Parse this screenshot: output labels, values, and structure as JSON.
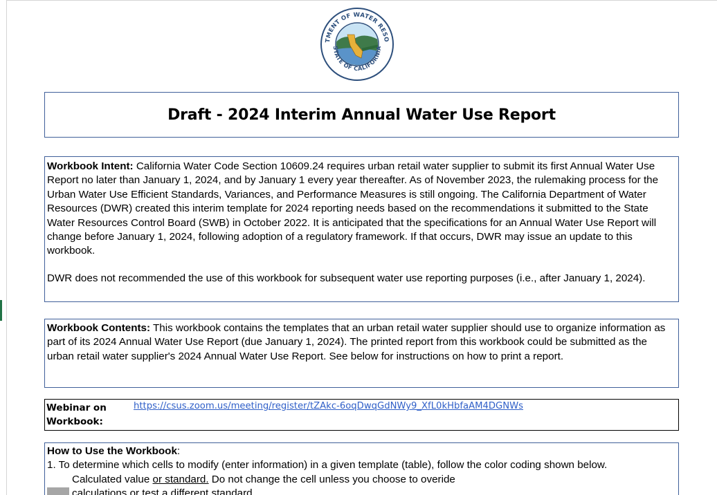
{
  "seal": {
    "top_text": "DEPARTMENT OF WATER RESOURCES",
    "bottom_text": "STATE OF CALIFORNIA",
    "colors": {
      "ring": "#2d4f7c",
      "sky": "#c8e3f4",
      "hills": "#3f7a4a",
      "state": "#e8b13a",
      "water": "#5a93c9"
    }
  },
  "title": "Draft - 2024 Interim Annual Water Use Report",
  "intent": {
    "heading": "Workbook Intent:",
    "body": " California Water Code Section 10609.24 requires urban retail water supplier to submit its first Annual Water Use Report no later than January 1, 2024, and by January 1 every year thereafter. As of November 2023, the rulemaking process for the Urban Water Use Efficient Standards, Variances, and Performance Measures is still ongoing. The California Department of Water Resources (DWR) created this interim template for 2024 reporting needs based on the recommendations it submitted to the State Water Resources Control Board (SWB) in October 2022. It is anticipated that the specifications for an Annual Water Use Report will change before January 1, 2024, following adoption of a regulatory framework. If that occurs, DWR may issue an update to this workbook.",
    "note": "DWR does not recommended the use of this workbook for subsequent water use reporting purposes (i.e., after January 1, 2024)."
  },
  "contents": {
    "heading": "Workbook Contents:",
    "body": " This workbook contains the templates that an urban retail water supplier should use to organize information as part of its 2024 Annual Water Use Report (due January 1, 2024). The printed report from this workbook could be submitted as the urban retail water supplier's 2024 Annual Water Use Report. See below for instructions on how to print a report."
  },
  "webinar": {
    "label": "Webinar on Workbook:",
    "link": "https://csus.zoom.us/meeting/register/tZAkc-6oqDwqGdNWy9_XfL0kHbfaAM4DGNWs"
  },
  "howto": {
    "heading": "How to Use the Workbook",
    "colon": ":",
    "step1": "1. To determine which cells to modify (enter information) in a given template (table), follow the color coding shown below.",
    "calc_prefix": "Calculated value ",
    "calc_underlined": "or standard.",
    "calc_suffix": " Do not change the cell unless you choose to overide",
    "calc_line2": "calculations or test a different standard.",
    "swatch_color": "#a6a6a6"
  }
}
